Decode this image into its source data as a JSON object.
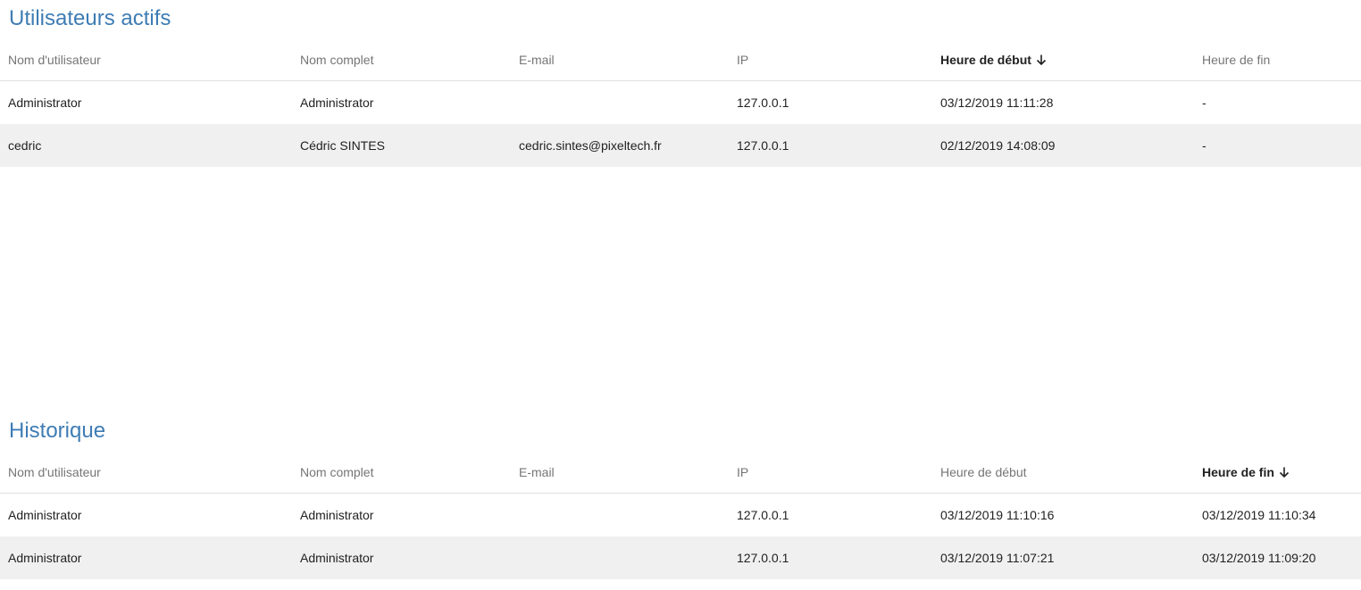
{
  "active": {
    "title": "Utilisateurs actifs",
    "columns": [
      "Nom d'utilisateur",
      "Nom complet",
      "E-mail",
      "IP",
      "Heure de début",
      "Heure de fin"
    ],
    "sorted_column": "Heure de début",
    "sort_icon": "arrow-down-icon",
    "rows": [
      [
        "Administrator",
        "Administrator",
        "",
        "127.0.0.1",
        "03/12/2019 11:11:28",
        "-"
      ],
      [
        "cedric",
        "Cédric SINTES",
        "cedric.sintes@pixeltech.fr",
        "127.0.0.1",
        "02/12/2019 14:08:09",
        "-"
      ]
    ]
  },
  "history": {
    "title": "Historique",
    "columns": [
      "Nom d'utilisateur",
      "Nom complet",
      "E-mail",
      "IP",
      "Heure de début",
      "Heure de fin"
    ],
    "sorted_column": "Heure de fin",
    "sort_icon": "arrow-down-icon",
    "rows": [
      [
        "Administrator",
        "Administrator",
        "",
        "127.0.0.1",
        "03/12/2019 11:10:16",
        "03/12/2019 11:10:34"
      ],
      [
        "Administrator",
        "Administrator",
        "",
        "127.0.0.1",
        "03/12/2019 11:07:21",
        "03/12/2019 11:09:20"
      ]
    ]
  },
  "colors": {
    "title": "#3e7cb4",
    "header_text": "#757575",
    "row_stripe": "#f0f0f0"
  }
}
